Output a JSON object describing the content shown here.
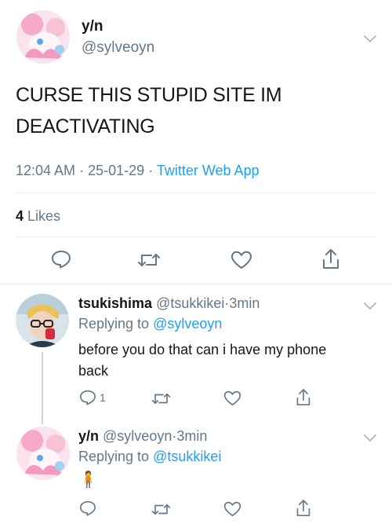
{
  "main_tweet": {
    "display_name": "y/n",
    "handle": "@sylveoyn",
    "text_line1": "CURSE THIS STUPID SITE IM",
    "text_line2": "DEACTIVATING",
    "time": "12:04 AM",
    "sep1": "·",
    "date": "25-01-29",
    "sep2": "·",
    "app": "Twitter Web App",
    "likes_count": "4",
    "likes_label": "Likes"
  },
  "replies": [
    {
      "display_name": "tsukishima",
      "handle": "@tsukkikei",
      "dot": "·",
      "time": "3min",
      "replying_prefix": "Replying to",
      "replying_to": "@sylveoyn",
      "text_line1": "before you do that can i have my phone",
      "text_line2": "back",
      "reply_count": "1"
    },
    {
      "display_name": "y/n",
      "handle": "@sylveoyn",
      "dot": "·",
      "time": "3min",
      "replying_prefix": "Replying to",
      "replying_to": "@tsukkikei",
      "emoji": "🧍"
    }
  ],
  "icons": [
    "chevron-down-icon",
    "reply-icon",
    "retweet-icon",
    "like-icon",
    "share-icon"
  ],
  "colors": {
    "accent": "#1da1f2",
    "secondary": "#657786",
    "text": "#14171a",
    "divider": "#e6ecf0"
  }
}
